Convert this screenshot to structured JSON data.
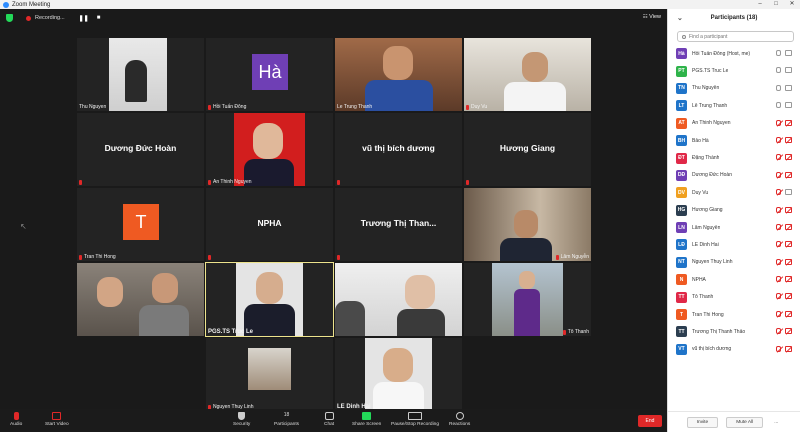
{
  "window": {
    "title": "Zoom Meeting",
    "controls": [
      "–",
      "□",
      "✕"
    ]
  },
  "topbar": {
    "recording_label": "Recording...",
    "pause_label": "❚❚",
    "stop_label": "■",
    "view_label": "View"
  },
  "tiles": [
    {
      "label": "Thu Nguyen"
    },
    {
      "label": "Hồi Tuấn Đông",
      "initials": "Hà",
      "color": "#6f3fb5"
    },
    {
      "label": "Le Trung Thanh"
    },
    {
      "label": "Duy Vu"
    },
    {
      "label": "",
      "display": "Dương Đức Hoàn"
    },
    {
      "label": "An Thinh Nguyen"
    },
    {
      "label": "",
      "display": "vũ thị bích dương"
    },
    {
      "label": "",
      "display": "Hương Giang"
    },
    {
      "label": "Tran Thi Hong",
      "initials": "T",
      "color": "#ef5a22"
    },
    {
      "label": "",
      "display": "NPHA"
    },
    {
      "label": "",
      "display": "Trương Thị Than..."
    },
    {
      "label": "Lâm Nguyễn"
    },
    {
      "label": ""
    },
    {
      "label": "PGS.TS Truc Le"
    },
    {
      "label": ""
    },
    {
      "label": "Tô Thanh"
    },
    {
      "label": "Nguyen Thuy Linh"
    },
    {
      "label": "LE Dinh Hai"
    }
  ],
  "toolbar": {
    "audio": "Audio",
    "start_video": "Start Video",
    "security": "Security",
    "participants": "Participants",
    "participants_count": "18",
    "chat": "Chat",
    "share_screen": "Share Screen",
    "pause_recording": "Pause/Stop Recording",
    "reactions": "Reactions",
    "end": "End"
  },
  "panel": {
    "title": "Participants (18)",
    "search_placeholder": "Find a participant",
    "participants": [
      {
        "name": "Hồi Tuấn Đông (Host, me)",
        "initials": "Hà",
        "color": "#6f3fb5",
        "mic": "on",
        "cam": "on"
      },
      {
        "name": "PGS.TS Truc Le",
        "initials": "PT",
        "color": "#2eb34a",
        "mic": "on",
        "cam": "on"
      },
      {
        "name": "Thu Nguyễn",
        "initials": "TN",
        "color": "#1f74c9",
        "mic": "on",
        "cam": "on"
      },
      {
        "name": "Lê Trung Thanh",
        "initials": "LT",
        "color": "#1f74c9",
        "mic": "on",
        "cam": "on"
      },
      {
        "name": "An Thinh Nguyen",
        "initials": "AT",
        "color": "#ef5a22",
        "mic": "muted",
        "cam": "muted"
      },
      {
        "name": "Bảo Hà",
        "initials": "BH",
        "color": "#1f74c9",
        "mic": "muted",
        "cam": "muted"
      },
      {
        "name": "Đặng Thành",
        "initials": "ĐT",
        "color": "#e02848",
        "mic": "muted",
        "cam": "muted"
      },
      {
        "name": "Dương Đức Hoàn",
        "initials": "DĐ",
        "color": "#6f3fb5",
        "mic": "muted",
        "cam": "muted"
      },
      {
        "name": "Duy Vu",
        "initials": "DV",
        "color": "#f0a020",
        "mic": "muted",
        "cam": "on"
      },
      {
        "name": "Hương Giang",
        "initials": "HG",
        "color": "#2c3e50",
        "mic": "muted",
        "cam": "muted"
      },
      {
        "name": "Lâm Nguyễn",
        "initials": "LN",
        "color": "#6f3fb5",
        "mic": "muted",
        "cam": "muted"
      },
      {
        "name": "LE Dinh Hai",
        "initials": "LĐ",
        "color": "#1f74c9",
        "mic": "muted",
        "cam": "muted"
      },
      {
        "name": "Nguyen Thuy Linh",
        "initials": "NT",
        "color": "#1f74c9",
        "mic": "muted",
        "cam": "muted"
      },
      {
        "name": "NPHA",
        "initials": "N",
        "color": "#ef5a22",
        "mic": "muted",
        "cam": "muted"
      },
      {
        "name": "Tô Thanh",
        "initials": "TT",
        "color": "#e02848",
        "mic": "muted",
        "cam": "muted"
      },
      {
        "name": "Tran Thi Hong",
        "initials": "T",
        "color": "#ef5a22",
        "mic": "muted",
        "cam": "muted"
      },
      {
        "name": "Trương Thị Thanh Thảo",
        "initials": "TT",
        "color": "#2c3e50",
        "mic": "muted",
        "cam": "muted"
      },
      {
        "name": "vũ thị bích dương",
        "initials": "VT",
        "color": "#1f74c9",
        "mic": "muted",
        "cam": "muted"
      }
    ],
    "invite_label": "Invite",
    "mute_all_label": "Mute All",
    "more_label": "..."
  }
}
